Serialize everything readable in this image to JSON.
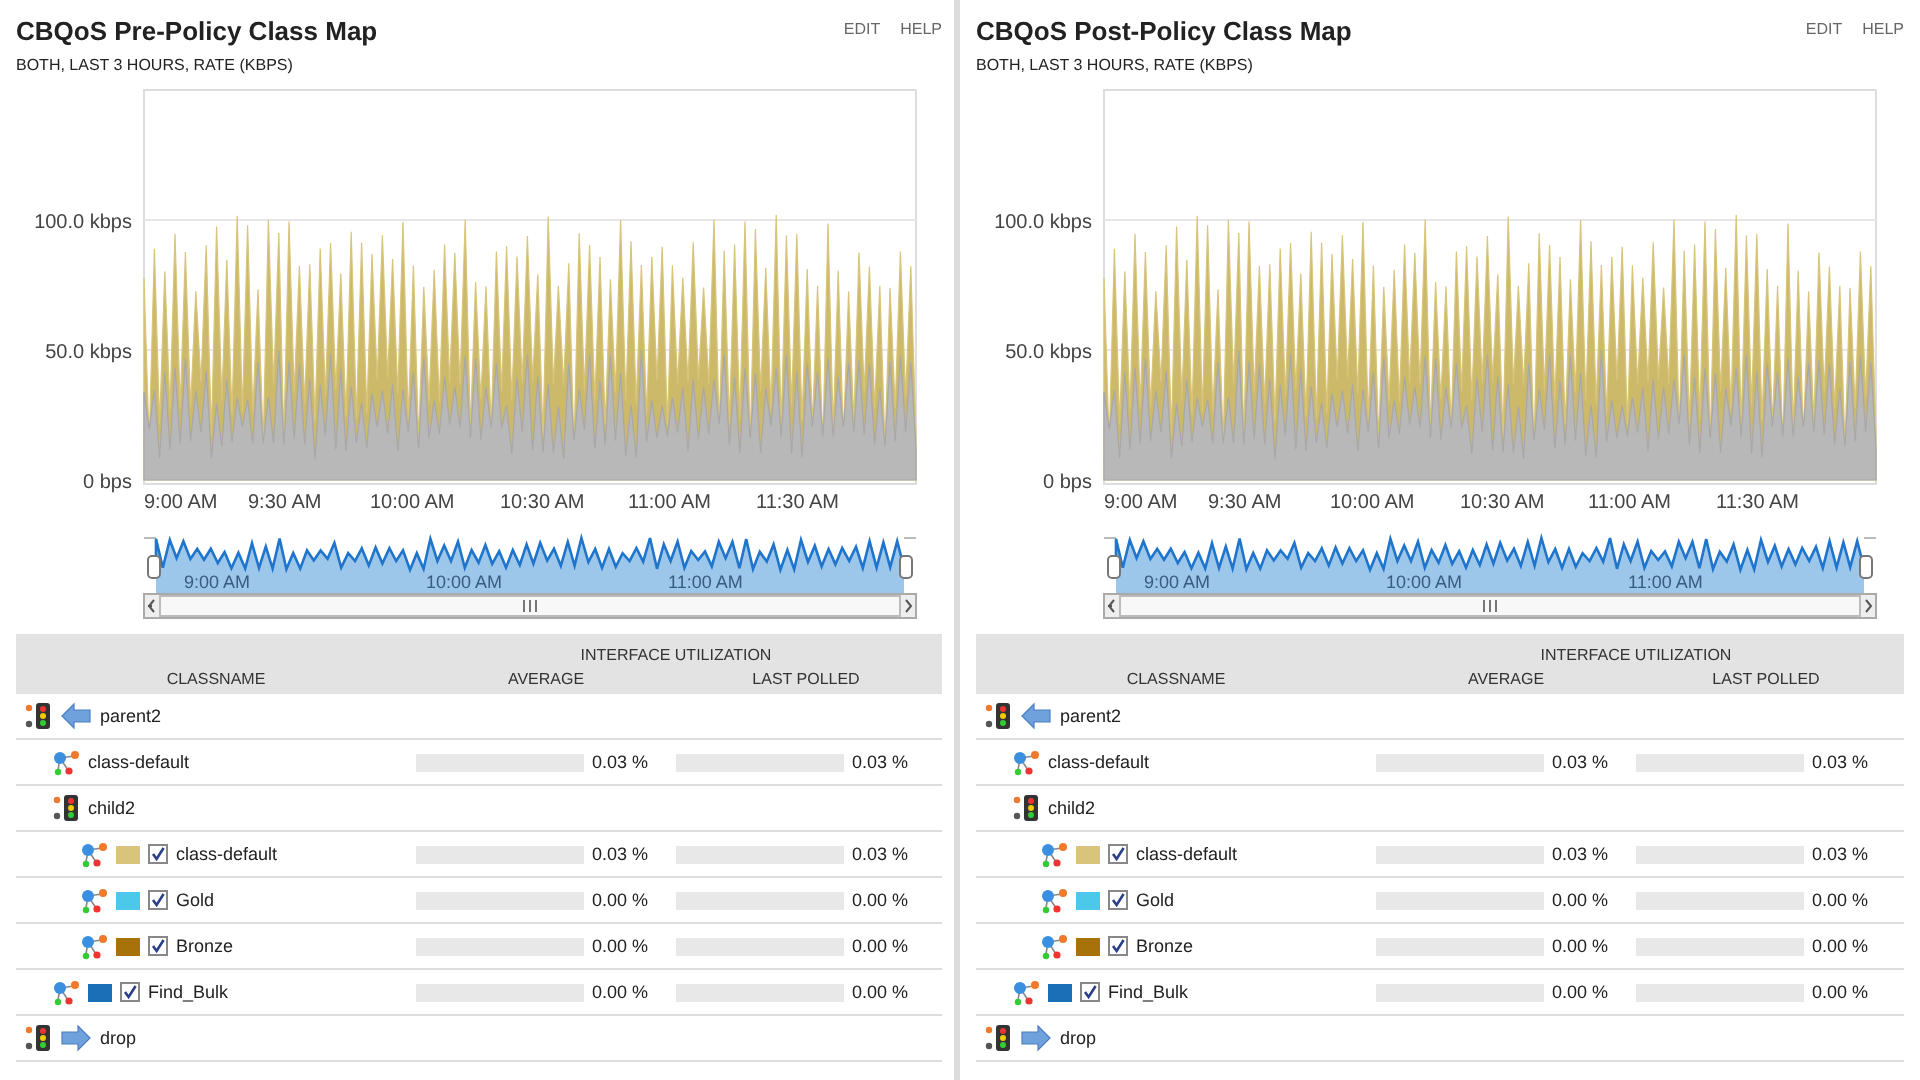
{
  "panels": [
    {
      "title": "CBQoS Pre-Policy Class Map",
      "subtitle": "BOTH, LAST 3 HOURS, RATE (KBPS)",
      "actions": [
        "EDIT",
        "HELP"
      ],
      "chart": {
        "y_labels": [
          "100.0 kbps",
          "50.0 kbps",
          "0 bps"
        ],
        "x_labels": [
          "9:00 AM",
          "9:30 AM",
          "10:00 AM",
          "10:30 AM",
          "11:00 AM",
          "11:30 AM"
        ],
        "navigator_labels": [
          "9:00 AM",
          "10:00 AM",
          "11:00 AM"
        ]
      },
      "table": {
        "group_header": "INTERFACE UTILIZATION",
        "columns": [
          "CLASSNAME",
          "AVERAGE",
          "LAST POLLED"
        ],
        "rows": [
          {
            "kind": "policy_left",
            "name": "parent2",
            "children": [
              {
                "kind": "class",
                "name": "class-default",
                "average": "0.03 %",
                "last_polled": "0.03 %"
              },
              {
                "kind": "policy",
                "name": "child2",
                "children": [
                  {
                    "kind": "class",
                    "name": "class-default",
                    "color": "#d8c47a",
                    "checked": true,
                    "average": "0.03 %",
                    "last_polled": "0.03 %"
                  },
                  {
                    "kind": "class",
                    "name": "Gold",
                    "color": "#4cc9ea",
                    "checked": true,
                    "average": "0.00 %",
                    "last_polled": "0.00 %"
                  },
                  {
                    "kind": "class",
                    "name": "Bronze",
                    "color": "#a8720a",
                    "checked": true,
                    "average": "0.00 %",
                    "last_polled": "0.00 %"
                  }
                ]
              },
              {
                "kind": "class",
                "name": "Find_Bulk",
                "color": "#1a6fb5",
                "checked": true,
                "average": "0.00 %",
                "last_polled": "0.00 %"
              }
            ]
          },
          {
            "kind": "policy_right",
            "name": "drop"
          }
        ]
      }
    },
    {
      "title": "CBQoS Post-Policy Class Map",
      "subtitle": "BOTH, LAST 3 HOURS, RATE (KBPS)",
      "actions": [
        "EDIT",
        "HELP"
      ],
      "chart": {
        "y_labels": [
          "100.0 kbps",
          "50.0 kbps",
          "0 bps"
        ],
        "x_labels": [
          "9:00 AM",
          "9:30 AM",
          "10:00 AM",
          "10:30 AM",
          "11:00 AM",
          "11:30 AM"
        ],
        "navigator_labels": [
          "9:00 AM",
          "10:00 AM",
          "11:00 AM"
        ]
      },
      "table": {
        "group_header": "INTERFACE UTILIZATION",
        "columns": [
          "CLASSNAME",
          "AVERAGE",
          "LAST POLLED"
        ],
        "rows": [
          {
            "kind": "policy_left",
            "name": "parent2",
            "children": [
              {
                "kind": "class",
                "name": "class-default",
                "average": "0.03 %",
                "last_polled": "0.03 %"
              },
              {
                "kind": "policy",
                "name": "child2",
                "children": [
                  {
                    "kind": "class",
                    "name": "class-default",
                    "color": "#d8c47a",
                    "checked": true,
                    "average": "0.03 %",
                    "last_polled": "0.03 %"
                  },
                  {
                    "kind": "class",
                    "name": "Gold",
                    "color": "#4cc9ea",
                    "checked": true,
                    "average": "0.00 %",
                    "last_polled": "0.00 %"
                  },
                  {
                    "kind": "class",
                    "name": "Bronze",
                    "color": "#a8720a",
                    "checked": true,
                    "average": "0.00 %",
                    "last_polled": "0.00 %"
                  }
                ]
              },
              {
                "kind": "class",
                "name": "Find_Bulk",
                "color": "#1a6fb5",
                "checked": true,
                "average": "0.00 %",
                "last_polled": "0.00 %"
              }
            ]
          },
          {
            "kind": "policy_right",
            "name": "drop"
          }
        ]
      }
    }
  ]
}
